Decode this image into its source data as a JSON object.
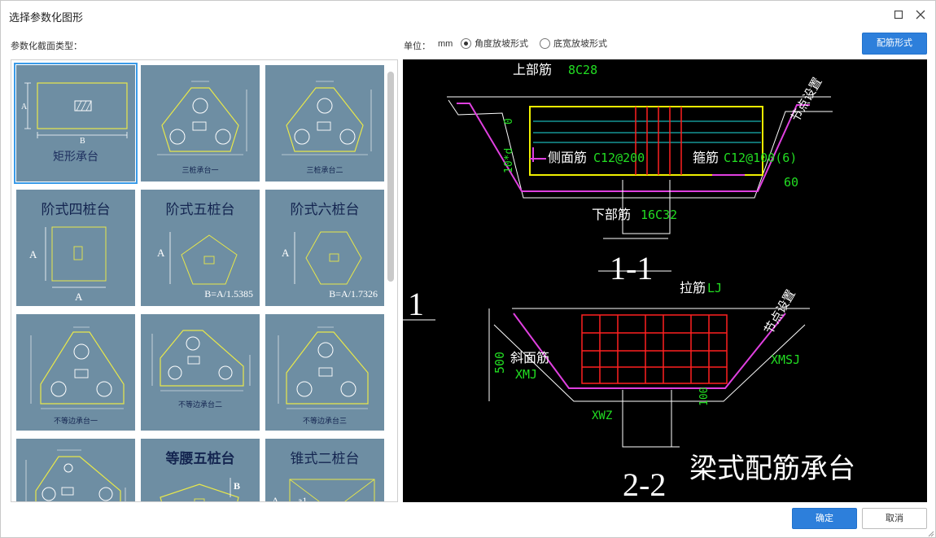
{
  "window": {
    "title": "选择参数化图形",
    "maximize_icon": "maximize-icon",
    "close_icon": "close-icon"
  },
  "toolbar": {
    "section_label": "参数化截面类型：",
    "unit_label": "单位：",
    "unit_value": "mm",
    "radio_angle": "角度放坡形式",
    "radio_width": "底宽放坡形式",
    "radio_selected": "角度放坡形式",
    "rebar_button": "配筋形式"
  },
  "gallery": {
    "tiles": [
      {
        "caption": "矩形承台",
        "sub": ""
      },
      {
        "caption": "三桩承台一",
        "sub": ""
      },
      {
        "caption": "三桩承台二",
        "sub": ""
      },
      {
        "caption": "阶式四桩台",
        "sub": ""
      },
      {
        "caption": "阶式五桩台",
        "sub": "B=A/1.5385"
      },
      {
        "caption": "阶式六桩台",
        "sub": "B=A/1.7326"
      },
      {
        "caption": "不等边承台一",
        "sub": ""
      },
      {
        "caption": "不等边承台二",
        "sub": ""
      },
      {
        "caption": "不等边承台三",
        "sub": ""
      },
      {
        "caption": "",
        "sub": ""
      },
      {
        "caption": "等腰五桩台",
        "sub": ""
      },
      {
        "caption": "锥式二桩台",
        "sub": ""
      }
    ],
    "selected_index": 0
  },
  "preview": {
    "section1": "1-1",
    "section2": "2-2",
    "side_mark": "1",
    "title": "梁式配筋承台",
    "top_bar": "上部筋",
    "top_bar_spec": "8C28",
    "side_bar": "侧面筋",
    "side_bar_spec": "C12@200",
    "stirrup": "箍筋",
    "stirrup_spec": "C12@100(6)",
    "bottom_bar": "下部筋",
    "bottom_bar_spec": "16C32",
    "node_setting": "节点设置",
    "angle": "60",
    "dim_0": "0",
    "dim_10d": "10*d",
    "tie_bar": "拉筋",
    "tie_bar_spec": "LJ",
    "slope_bar": "斜面筋",
    "slope_bar_spec": "XMJ",
    "xmsj": "XMSJ",
    "xwz": "XWZ",
    "dim_500": "500",
    "dim_100": "100"
  },
  "footer": {
    "ok": "确定",
    "cancel": "取消"
  },
  "colors": {
    "accent": "#2d7fdb",
    "tile_bg": "#6e8ea3",
    "cad_green": "#22dd22",
    "cad_magenta": "#e040e0",
    "cad_red": "#ff2020",
    "cad_yellow": "#f0f000",
    "cad_cyan": "#20e0e0"
  }
}
